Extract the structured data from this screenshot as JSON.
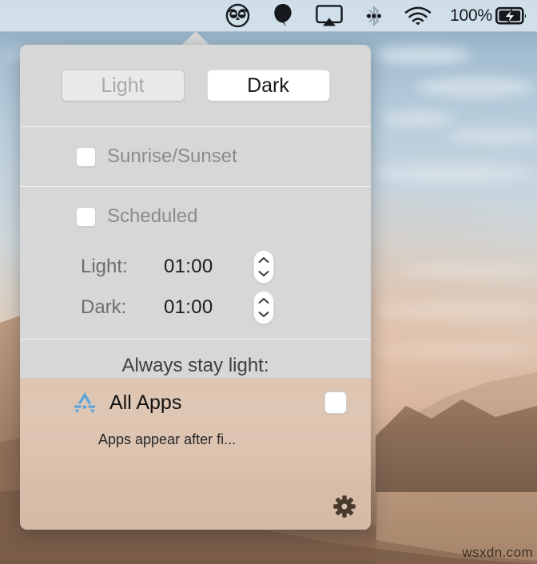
{
  "menubar": {
    "items": [
      {
        "name": "nightowl-icon",
        "label": ""
      },
      {
        "name": "balloon-icon",
        "label": ""
      },
      {
        "name": "airplay-icon",
        "label": ""
      },
      {
        "name": "bluetooth-icon",
        "label": ""
      },
      {
        "name": "wifi-icon",
        "label": ""
      }
    ],
    "battery_percent": "100%",
    "battery_state": "charging"
  },
  "popover": {
    "modes": {
      "light_label": "Light",
      "dark_label": "Dark",
      "selected": "Dark"
    },
    "sunrise_sunset": {
      "label": "Sunrise/Sunset",
      "checked": false
    },
    "scheduled": {
      "label": "Scheduled",
      "checked": false
    },
    "times": [
      {
        "label": "Light:",
        "value": "01:00"
      },
      {
        "label": "Dark:",
        "value": "01:00"
      }
    ],
    "always_stay_light_label": "Always stay light:",
    "apps": [
      {
        "icon": "app-store-icon",
        "name": "All Apps",
        "checked": false
      }
    ],
    "apps_hint": "Apps appear after fi...",
    "settings_icon": "gear-icon"
  },
  "watermark": "wsxdn.com",
  "colors": {
    "popover_bg": "#d7d7d7",
    "separator": "#eeeeee",
    "active_button_bg": "#ffffff",
    "inactive_button_bg": "#e9e9e9",
    "inactive_text": "#a9a9a9",
    "app_icon_blue": "#59a3d9",
    "applist_bg": "#dec4b0"
  }
}
